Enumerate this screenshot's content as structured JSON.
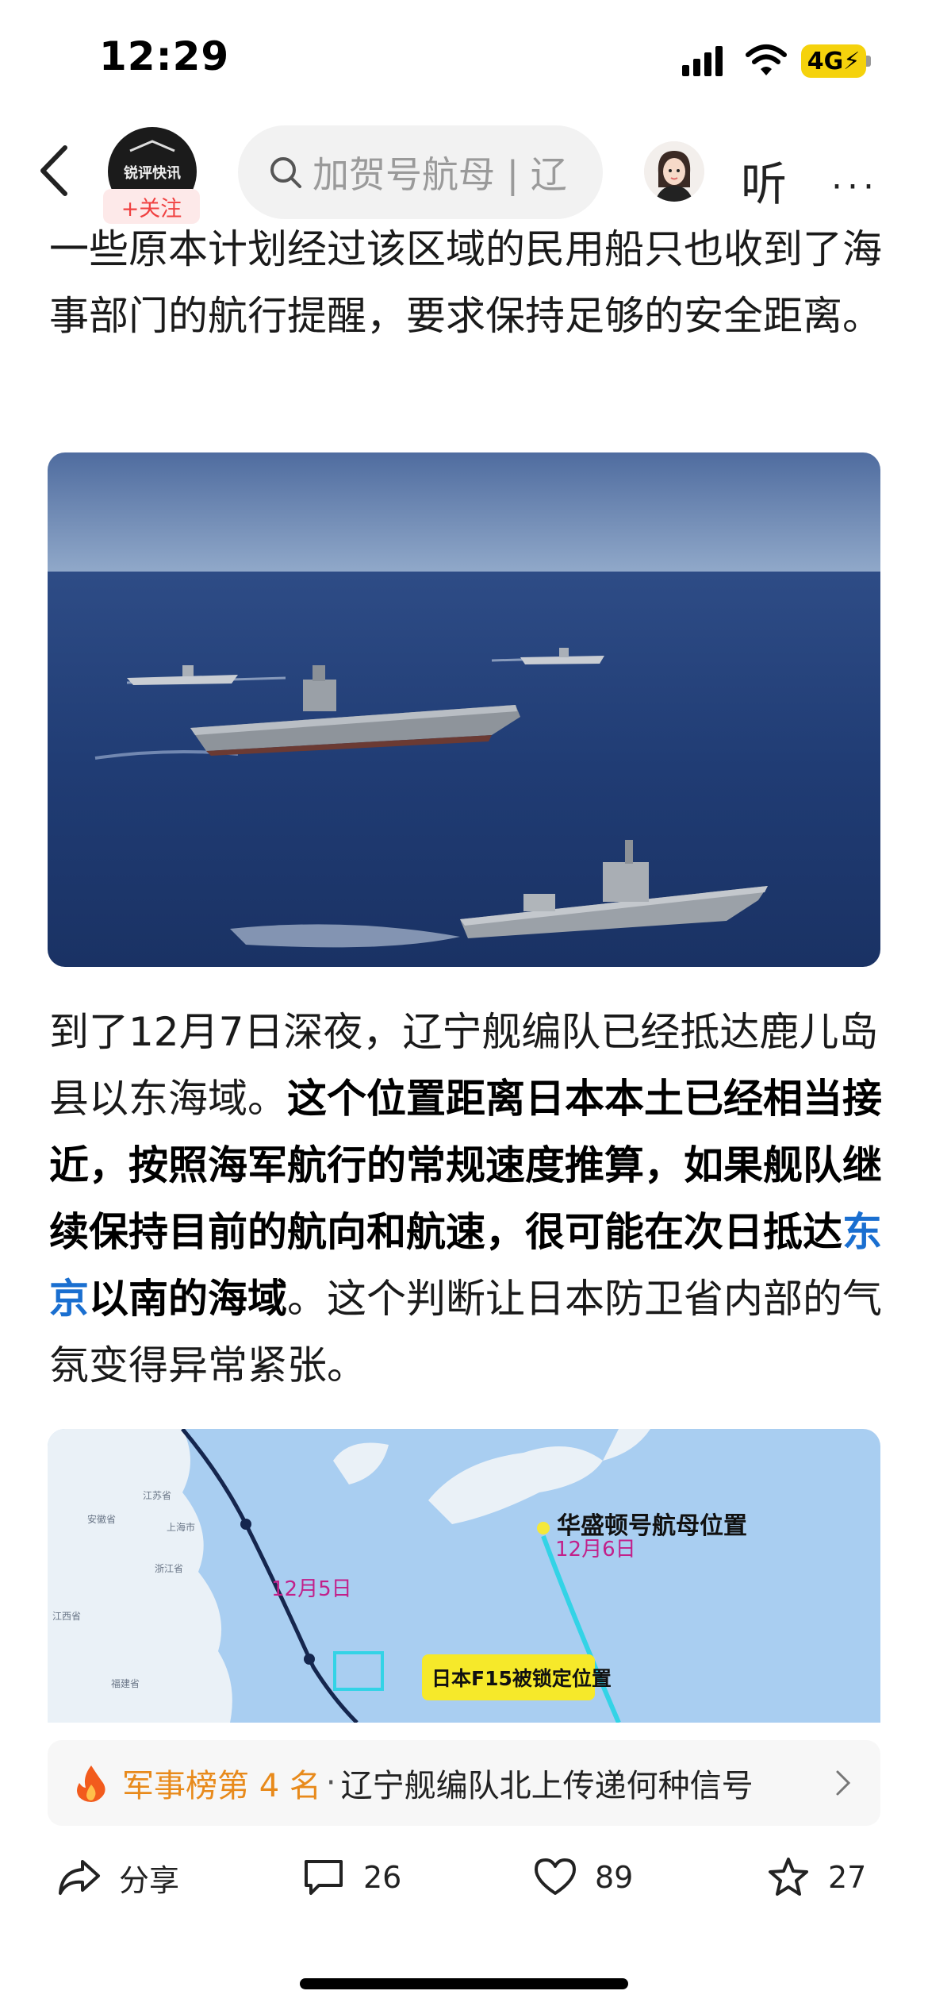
{
  "status_bar": {
    "time": "12:29",
    "network": "4G"
  },
  "nav": {
    "follow_label": "+关注",
    "account_logo_text": "锐评快讯",
    "search_text": "加贺号航母 | 辽",
    "listen_label": "听",
    "more_label": "···"
  },
  "article": {
    "para1": "一些原本计划经过该区域的民用船只也收到了海事部门的航行提醒，要求保持足够的安全距离。",
    "para2": {
      "part1": "到了12月7日深夜，辽宁舰编队已经抵达鹿儿岛县以东海域。",
      "bold1": "这个位置距离日本本土已经相当接近，按照海军航行的常规速度推算，如果舰队继续保持目前的航向和航速，很可能在次日抵达",
      "link": "东京",
      "bold2": "以南的海域",
      "part2": "。这个判断让日本防卫省内部的气氛变得异常紧张。"
    },
    "map": {
      "date1": "12月5日",
      "date2": "12月6日",
      "label1": "华盛顿号航母位置",
      "label2": "日本F15被锁定位置",
      "city1": "江苏省",
      "city2": "上海市",
      "city3": "浙江省",
      "city4": "安徽省",
      "city5": "江西省",
      "city6": "福建省"
    }
  },
  "rank": {
    "label": "军事榜第 4 名",
    "separator": "·",
    "title": "辽宁舰编队北上传递何种信号"
  },
  "actions": {
    "share_label": "分享",
    "comment_count": "26",
    "like_count": "89",
    "fav_count": "27"
  },
  "colors": {
    "accent_orange": "#e88a1b",
    "link_blue": "#1a6fd0",
    "follow_red": "#f04141",
    "battery_yellow": "#f5d20c"
  }
}
